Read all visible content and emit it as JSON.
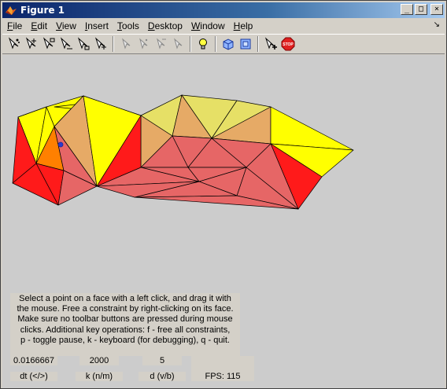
{
  "window": {
    "title": "Figure 1"
  },
  "window_buttons": {
    "minimize": "_",
    "maximize": "□",
    "close": "×"
  },
  "menu": [
    {
      "label": "File",
      "ul": "F",
      "rest": "ile"
    },
    {
      "label": "Edit",
      "ul": "E",
      "rest": "dit"
    },
    {
      "label": "View",
      "ul": "V",
      "rest": "iew"
    },
    {
      "label": "Insert",
      "ul": "I",
      "rest": "nsert"
    },
    {
      "label": "Tools",
      "ul": "T",
      "rest": "ools"
    },
    {
      "label": "Desktop",
      "ul": "D",
      "rest": "esktop"
    },
    {
      "label": "Window",
      "ul": "W",
      "rest": "indow"
    },
    {
      "label": "Help",
      "ul": "H",
      "rest": "elp"
    }
  ],
  "menu_arrow": "↘",
  "toolbar_icons": [
    "cursor-sparkle-icon",
    "cursor-sparkle-icon",
    "cursor-sparkle-icon",
    "cursor-sparkle-icon",
    "cursor-sparkle-icon",
    "cursor-sparkle-icon",
    "cursor-disabled-icon",
    "cursor-disabled-icon",
    "cursor-disabled-icon",
    "cursor-disabled-icon",
    "lightbulb-icon",
    "cube-icon",
    "cube-flat-icon",
    "cursor-add-icon",
    "stop-icon"
  ],
  "stop_label": "STOP",
  "instructions": {
    "line1": "Select a point on a face with a left click, and drag it with",
    "line2": "the mouse. Free a constraint by right-clicking on its face.",
    "line3": "Make sure no toolbar buttons are pressed during mouse",
    "line4": "clicks.  Additional key operations: f - free all constraints,",
    "line5": "p - toggle pause, k - keyboard (for debugging),  q - quit."
  },
  "stats": {
    "dt_value": "0.0166667",
    "k_value": "2000",
    "d_value": "5",
    "dt_label": "dt (</>)",
    "k_label": "k (n/m)",
    "d_label": "d (v/b)",
    "fps": "FPS: 115"
  },
  "colors": {
    "yellow": "#ffff00",
    "pale_yellow": "#e6e066",
    "orange_tan": "#e6aa66",
    "red": "#ff1a1a",
    "salmon": "#e66666",
    "orange": "#ff8000",
    "marker": "#2a3ad0",
    "edge": "#000000"
  }
}
